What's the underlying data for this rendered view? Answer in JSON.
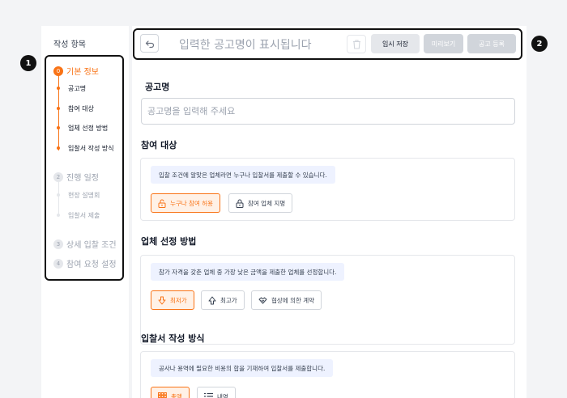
{
  "markers": {
    "sidebar": "1",
    "toolbar": "2"
  },
  "sidebar": {
    "heading": "작성 항목",
    "steps": [
      {
        "num": "0",
        "label": "기본 정보",
        "subs": [
          "공고명",
          "참여 대상",
          "업체 선정 방법",
          "입찰서 작성 방식"
        ]
      },
      {
        "num": "2",
        "label": "진행 일정",
        "subs": [
          "현장 설명회",
          "입찰서 제출"
        ]
      },
      {
        "num": "3",
        "label": "상세 입찰 조건",
        "subs": []
      },
      {
        "num": "4",
        "label": "참여 요청 설정",
        "subs": []
      }
    ]
  },
  "toolbar": {
    "title": "입력한 공고명이 표시됩니다",
    "save_label": "임시 저장",
    "preview_label": "미리보기",
    "submit_label": "공고 등록"
  },
  "form": {
    "title_section": {
      "label": "공고명",
      "placeholder": "공고명을 입력해 주세요"
    },
    "participants": {
      "label": "참여 대상",
      "info": "입찰 조건에 알맞은 업체라면 누구나 입찰서를 제출할 수 있습니다.",
      "options": [
        "누구나 참여 허용",
        "참여 업체 지명"
      ]
    },
    "selection": {
      "label": "업체 선정 방법",
      "info": "참가 자격을 갖춘 업체 중 가장 낮은 금액을 제출한 업체를 선정합니다.",
      "options": [
        "최저가",
        "최고가",
        "협상에 의한 계약"
      ]
    },
    "bid_format": {
      "label": "입찰서 작성 방식",
      "info": "공사나 용역에 필요한 비용의 합을 기재하여 입찰서를 제출합니다.",
      "options": [
        "총액",
        "내역"
      ]
    }
  },
  "colors": {
    "accent": "#f97316",
    "info_bg": "#eef2ff",
    "muted": "#9ca3af"
  }
}
